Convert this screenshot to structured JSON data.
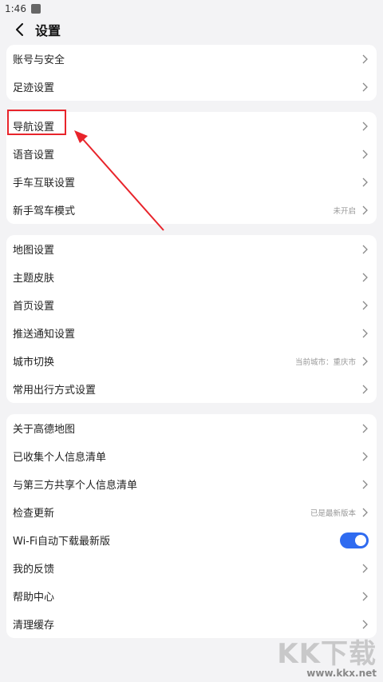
{
  "status_bar": {
    "time": "1:46"
  },
  "header": {
    "title": "设置"
  },
  "groups": [
    {
      "items": [
        {
          "label": "账号与安全",
          "value": ""
        },
        {
          "label": "足迹设置",
          "value": ""
        }
      ]
    },
    {
      "items": [
        {
          "label": "导航设置",
          "value": ""
        },
        {
          "label": "语音设置",
          "value": ""
        },
        {
          "label": "手车互联设置",
          "value": ""
        },
        {
          "label": "新手驾车模式",
          "value": "未开启"
        }
      ]
    },
    {
      "items": [
        {
          "label": "地图设置",
          "value": ""
        },
        {
          "label": "主题皮肤",
          "value": ""
        },
        {
          "label": "首页设置",
          "value": ""
        },
        {
          "label": "推送通知设置",
          "value": ""
        },
        {
          "label": "城市切换",
          "value": "当前城市：重庆市"
        },
        {
          "label": "常用出行方式设置",
          "value": ""
        }
      ]
    },
    {
      "items": [
        {
          "label": "关于高德地图",
          "value": ""
        },
        {
          "label": "已收集个人信息清单",
          "value": ""
        },
        {
          "label": "与第三方共享个人信息清单",
          "value": ""
        },
        {
          "label": "检查更新",
          "value": "已是最新版本"
        },
        {
          "label": "Wi-Fi自动下载最新版",
          "value": "",
          "toggle_on": true
        },
        {
          "label": "我的反馈",
          "value": ""
        },
        {
          "label": "帮助中心",
          "value": ""
        },
        {
          "label": "清理缓存",
          "value": ""
        }
      ]
    }
  ],
  "colors": {
    "accent": "#2f6bf0",
    "annotation": "#e8242b"
  },
  "watermark": {
    "logo": "KK下载",
    "url": "www.kkx.net"
  }
}
